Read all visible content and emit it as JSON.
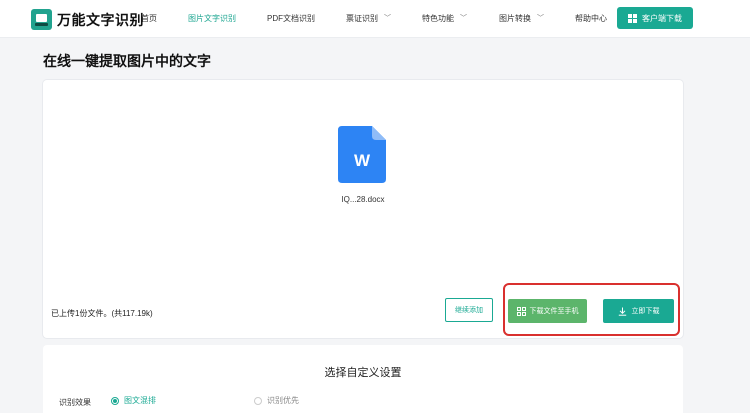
{
  "header": {
    "brand": "万能文字识别",
    "nav": [
      {
        "label": "首页"
      },
      {
        "label": "图片文字识别"
      },
      {
        "label": "PDF文档识别"
      },
      {
        "label": "票证识别"
      },
      {
        "label": "特色功能"
      },
      {
        "label": "图片转换"
      },
      {
        "label": "帮助中心"
      }
    ],
    "client_download": "客户端下载"
  },
  "page": {
    "title": "在线一键提取图片中的文字"
  },
  "upload": {
    "file_icon_letter": "W",
    "file_name": "IQ...28.docx",
    "status": "已上传1份文件。(共117.19k)",
    "continue_label": "继续添加",
    "send_to_phone_label": "下载文件至手机",
    "download_label": "立即下载"
  },
  "settings": {
    "title": "选择自定义设置",
    "label": "识别效果",
    "options": [
      {
        "label": "图文混排",
        "selected": true
      },
      {
        "label": "识别优先",
        "selected": false
      }
    ]
  },
  "colors": {
    "accent": "#1aa993",
    "phone_button": "#5cb56b",
    "highlight": "#d9302e",
    "word_blue": "#2d84f4"
  }
}
